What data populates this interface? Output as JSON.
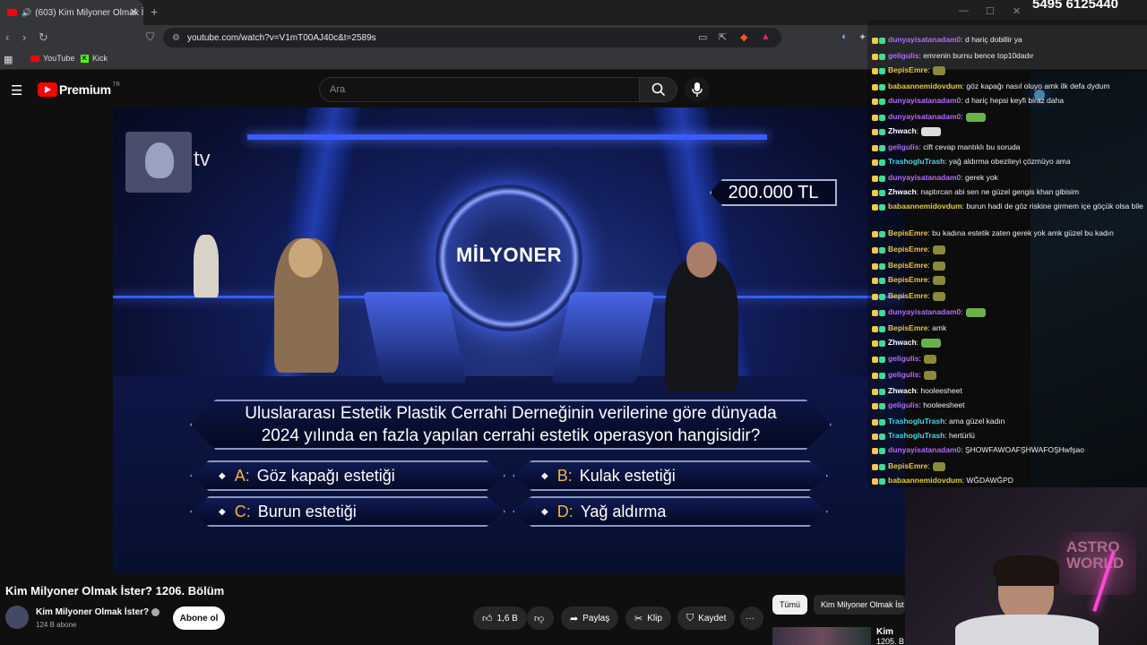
{
  "browser": {
    "tab_title": "(603) Kim Milyoner Olmak İst",
    "url": "youtube.com/watch?v=V1mT00AJ40c&t=2589s",
    "bookmarks": [
      {
        "label": "YouTube"
      },
      {
        "label": "Kick"
      }
    ],
    "phone_overlay": "5495 6125440"
  },
  "yt": {
    "logo_text": "Premium",
    "logo_suffix": "TR",
    "search_placeholder": "Ara"
  },
  "video": {
    "channel_tag": "tv",
    "prize": "200.000 TL",
    "logo_text": "MİLYONER",
    "question_line1": "Uluslararası Estetik Plastik Cerrahi Derneğinin verilerine göre dünyada",
    "question_line2": "2024 yılında en fazla yapılan cerrahi estetik operasyon hangisidir?",
    "answers": [
      {
        "letter": "A:",
        "text": "Göz kapağı estetiği"
      },
      {
        "letter": "B:",
        "text": "Kulak estetiği"
      },
      {
        "letter": "C:",
        "text": "Burun estetiği"
      },
      {
        "letter": "D:",
        "text": "Yağ aldırma"
      }
    ]
  },
  "below": {
    "title": "Kim Milyoner Olmak İster? 1206. Bölüm",
    "channel": "Kim Milyoner Olmak İster?",
    "subs": "124 B abone",
    "subscribe": "Abone ol",
    "likes": "1,6 B",
    "share": "Paylaş",
    "clip": "Klip",
    "save": "Kaydet",
    "more": "···",
    "chips": [
      {
        "label": "Tümü"
      },
      {
        "label": "Kim Milyoner Olmak İst"
      }
    ],
    "reco_title": "Kim",
    "reco_sub": "1205. B"
  },
  "chat": {
    "messages": [
      {
        "user": "dunyayisatanadam0",
        "color": "#b36bff",
        "text": ": d hariç dobillir ya"
      },
      {
        "user": "geligulis",
        "color": "#b36bff",
        "text": ": emrenin burnu bence top10dadır"
      },
      {
        "user": "BepisEmre",
        "color": "#e6c84a",
        "text": ":"
      },
      {
        "user": "babaannemidovdum",
        "color": "#e6c84a",
        "text": ": göz kapağı nasıl oluyo amk ilk defa dydum"
      },
      {
        "user": "dunyayisatanadam0",
        "color": "#b36bff",
        "text": ": d hariç hepsi keyfi biraz daha"
      },
      {
        "user": "dunyayisatanadam0",
        "color": "#b36bff",
        "text": ":"
      },
      {
        "user": "Zhwach",
        "color": "#ffffff",
        "text": ":"
      },
      {
        "user": "geligulis",
        "color": "#b36bff",
        "text": ": cift cevap mantıklı bu soruda"
      },
      {
        "user": "TrashogluTrash",
        "color": "#4ad8e0",
        "text": ": yağ aldırma obeziteyi çözmüyo ama"
      },
      {
        "user": "dunyayisatanadam0",
        "color": "#b36bff",
        "text": ": gerek yok"
      },
      {
        "user": "Zhwach",
        "color": "#ffffff",
        "text": ": naptırcan abi sen ne güzel gengis khan gibisim"
      },
      {
        "user": "babaannemidovdum",
        "color": "#e6c84a",
        "text": ": burun hadi de göz riskine girmem içe göçük olsa bile"
      },
      {
        "user": "BepisEmre",
        "color": "#e6c84a",
        "text": ": bu kadına estetik zaten gerek yok amk güzel bu kadın"
      },
      {
        "user": "BepisEmre",
        "color": "#e6c84a",
        "text": ":"
      },
      {
        "user": "BepisEmre",
        "color": "#e6c84a",
        "text": ":"
      },
      {
        "user": "BepisEmre",
        "color": "#e6c84a",
        "text": ":"
      },
      {
        "user": "BepisEmre",
        "color": "#e6c84a",
        "text": ":"
      },
      {
        "user": "dunyayisatanadam0",
        "color": "#b36bff",
        "text": ":"
      },
      {
        "user": "BepisEmre",
        "color": "#e6c84a",
        "text": ": amk"
      },
      {
        "user": "Zhwach",
        "color": "#ffffff",
        "text": ":"
      },
      {
        "user": "geligulis",
        "color": "#b36bff",
        "text": ":"
      },
      {
        "user": "geligulis",
        "color": "#b36bff",
        "text": ":"
      },
      {
        "user": "Zhwach",
        "color": "#ffffff",
        "text": ": hooleesheet"
      },
      {
        "user": "geligulis",
        "color": "#b36bff",
        "text": ": hooleesheet"
      },
      {
        "user": "TrashogluTrash",
        "color": "#4ad8e0",
        "text": ": ama güzel kadın"
      },
      {
        "user": "TrashogluTrash",
        "color": "#4ad8e0",
        "text": ": hertürlü"
      },
      {
        "user": "dunyayisatanadam0",
        "color": "#b36bff",
        "text": ": ŞHOWFAWOAFŞHWAFOŞHwfşao"
      },
      {
        "user": "BepisEmre",
        "color": "#e6c84a",
        "text": ":"
      },
      {
        "user": "babaannemidovdum",
        "color": "#e6c84a",
        "text": ": WĞDAWĞPD"
      }
    ]
  },
  "webcam": {
    "sign_text": "ASTRO WORLD"
  }
}
